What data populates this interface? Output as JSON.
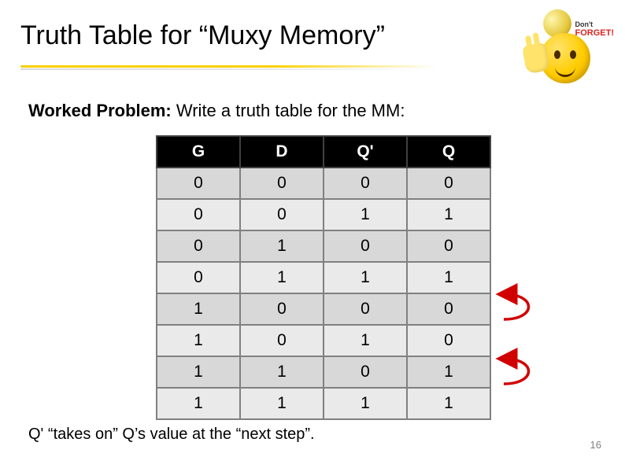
{
  "title": "Truth Table for “Muxy Memory”",
  "subtitle_bold": "Worked Problem:",
  "subtitle_rest": " Write a truth table for the MM:",
  "headers": [
    "G",
    "D",
    "Q'",
    "Q"
  ],
  "rows": [
    [
      "0",
      "0",
      "0",
      "0"
    ],
    [
      "0",
      "0",
      "1",
      "1"
    ],
    [
      "0",
      "1",
      "0",
      "0"
    ],
    [
      "0",
      "1",
      "1",
      "1"
    ],
    [
      "1",
      "0",
      "0",
      "0"
    ],
    [
      "1",
      "0",
      "1",
      "0"
    ],
    [
      "1",
      "1",
      "0",
      "1"
    ],
    [
      "1",
      "1",
      "1",
      "1"
    ]
  ],
  "footnote": "Q' “takes on” Q’s value at the “next step”.",
  "page_number": "16",
  "reminder_top": "Don't",
  "reminder_bottom": "FORGET!",
  "chart_data": {
    "type": "table",
    "title": "Truth Table for Muxy Memory",
    "columns": [
      "G",
      "D",
      "Q'",
      "Q"
    ],
    "data": [
      {
        "G": 0,
        "D": 0,
        "Qp": 0,
        "Q": 0
      },
      {
        "G": 0,
        "D": 0,
        "Qp": 1,
        "Q": 1
      },
      {
        "G": 0,
        "D": 1,
        "Qp": 0,
        "Q": 0
      },
      {
        "G": 0,
        "D": 1,
        "Qp": 1,
        "Q": 1
      },
      {
        "G": 1,
        "D": 0,
        "Qp": 0,
        "Q": 0
      },
      {
        "G": 1,
        "D": 0,
        "Qp": 1,
        "Q": 0
      },
      {
        "G": 1,
        "D": 1,
        "Qp": 0,
        "Q": 1
      },
      {
        "G": 1,
        "D": 1,
        "Qp": 1,
        "Q": 1
      }
    ]
  }
}
